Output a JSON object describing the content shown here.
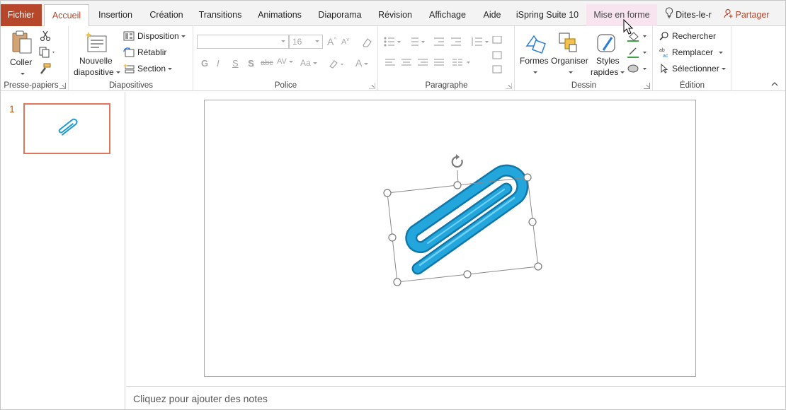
{
  "tabs": {
    "file": "Fichier",
    "home": "Accueil",
    "insert": "Insertion",
    "design": "Création",
    "transitions": "Transitions",
    "animations": "Animations",
    "slideshow": "Diaporama",
    "review": "Révision",
    "view": "Affichage",
    "help": "Aide",
    "ispring": "iSpring Suite 10",
    "format": "Mise en forme",
    "tellme": "Dites-le-r",
    "share": "Partager"
  },
  "clipboard": {
    "paste": "Coller",
    "label": "Presse-papiers"
  },
  "slides": {
    "new_line1": "Nouvelle",
    "new_line2": "diapositive",
    "layout": "Disposition",
    "reset": "Rétablir",
    "section": "Section",
    "label": "Diapositives"
  },
  "font": {
    "size": "16",
    "bold": "G",
    "italic": "I",
    "underline": "S",
    "shadow": "S",
    "strike": "abc",
    "spacing": "AV",
    "case": "Aa",
    "label": "Police"
  },
  "paragraph": {
    "label": "Paragraphe"
  },
  "drawing": {
    "shapes": "Formes",
    "arrange": "Organiser",
    "styles_line1": "Styles",
    "styles_line2": "rapides",
    "label": "Dessin"
  },
  "editing": {
    "find": "Rechercher",
    "replace": "Remplacer",
    "select": "Sélectionner",
    "label": "Édition"
  },
  "thumbnails": {
    "slide_number": "1"
  },
  "notes": {
    "placeholder": "Cliquez pour ajouter des notes"
  },
  "colors": {
    "accent": "#b7472a",
    "context_tab": "#f7e4ee",
    "thumb_border": "#e1765a",
    "paperclip": "#1f9bd1"
  },
  "icons": [
    "cut-icon",
    "copy-icon",
    "format-painter-icon",
    "rotate-handle-icon",
    "lightbulb-icon",
    "person-icon",
    "find-icon",
    "cursor-icon"
  ]
}
